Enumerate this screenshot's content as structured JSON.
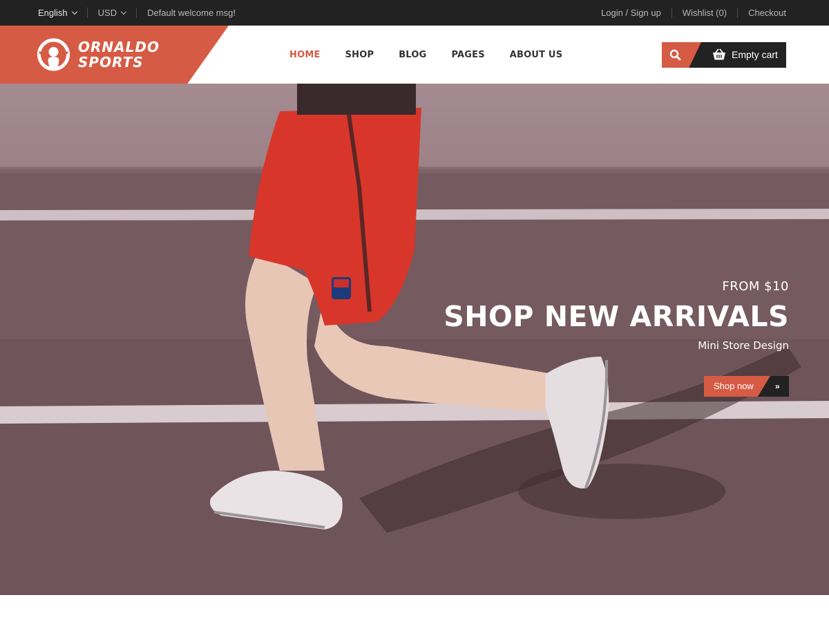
{
  "topbar": {
    "language": "English",
    "currency": "USD",
    "welcome": "Default welcome msg!",
    "login": "Login / Sign up",
    "wishlist": "Wishlist (0)",
    "checkout": "Checkout"
  },
  "header": {
    "logo_line1": "ORNALDO",
    "logo_line2": "SPORTS",
    "nav": [
      "HOME",
      "SHOP",
      "BLOG",
      "PAGES",
      "ABOUT US"
    ],
    "active_nav": "HOME",
    "cart_label": "Empty cart"
  },
  "hero": {
    "price_line": "FROM $10",
    "headline": "SHOP NEW ARRIVALS",
    "subline": "Mini Store Design",
    "button_label": "Shop now",
    "button_arrow": "»"
  },
  "colors": {
    "accent": "#d65b45",
    "dark": "#222222",
    "nav_text": "#333333"
  },
  "icons": [
    "chevron-down-icon",
    "search-icon",
    "cart-icon",
    "double-chevron-right-icon",
    "logo-mark"
  ]
}
